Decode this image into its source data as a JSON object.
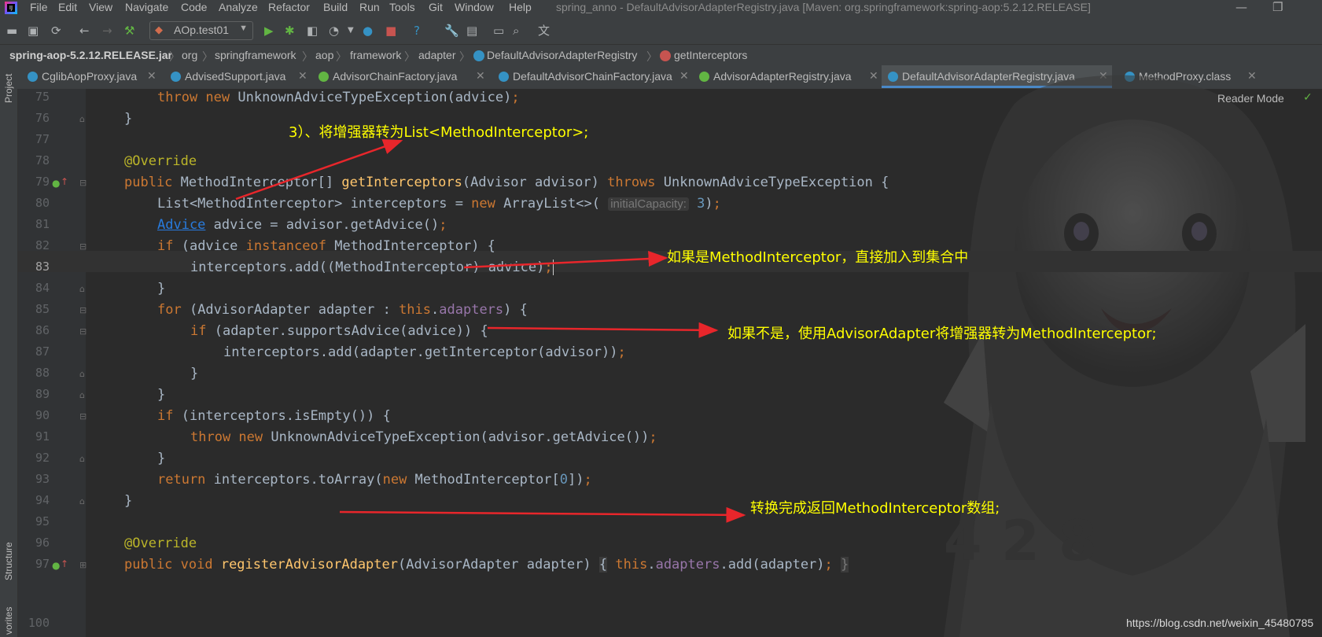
{
  "menubar": {
    "items": [
      "File",
      "Edit",
      "View",
      "Navigate",
      "Code",
      "Analyze",
      "Refactor",
      "Build",
      "Run",
      "Tools",
      "Git",
      "Window",
      "Help"
    ],
    "window_title": "spring_anno - DefaultAdvisorAdapterRegistry.java [Maven: org.springframework:spring-aop:5.2.12.RELEASE]"
  },
  "toolbar": {
    "run_config": "AOp.test01"
  },
  "breadcrumb": [
    "spring-aop-5.2.12.RELEASE.jar",
    "org",
    "springframework",
    "aop",
    "framework",
    "adapter",
    "DefaultAdvisorAdapterRegistry",
    "getInterceptors"
  ],
  "tabs": [
    {
      "label": "CglibAopProxy.java"
    },
    {
      "label": "AdvisedSupport.java"
    },
    {
      "label": "AdvisorChainFactory.java"
    },
    {
      "label": "DefaultAdvisorChainFactory.java"
    },
    {
      "label": "AdvisorAdapterRegistry.java"
    },
    {
      "label": "DefaultAdvisorAdapterRegistry.java",
      "active": true
    },
    {
      "label": "MethodProxy.class"
    }
  ],
  "sidebar": {
    "project": "Project",
    "structure": "Structure",
    "favorites": "vorites"
  },
  "editor": {
    "reader_mode": "Reader Mode",
    "inlay_hint": "initialCapacity:",
    "line_numbers": [
      "75",
      "76",
      "77",
      "78",
      "79",
      "80",
      "81",
      "82",
      "83",
      "84",
      "85",
      "86",
      "87",
      "88",
      "89",
      "90",
      "91",
      "92",
      "93",
      "94",
      "95",
      "96",
      "97",
      "100"
    ],
    "current_line": "83"
  },
  "annotations": {
    "a1": "3）、将增强器转为List<MethodInterceptor>;",
    "a2": "如果是MethodInterceptor，直接加入到集合中",
    "a3": "如果不是，使用AdvisorAdapter将增强器转为MethodInterceptor;",
    "a4": "转换完成返回MethodInterceptor数组;"
  },
  "watermark": "https://blog.csdn.net/weixin_45480785",
  "colors": {
    "keyword": "#cc7832",
    "method": "#ffc66d",
    "annotation": "#bbb529",
    "field": "#9876aa",
    "number": "#6897bb",
    "callout": "#ffff00",
    "arrow": "#e8262b"
  }
}
